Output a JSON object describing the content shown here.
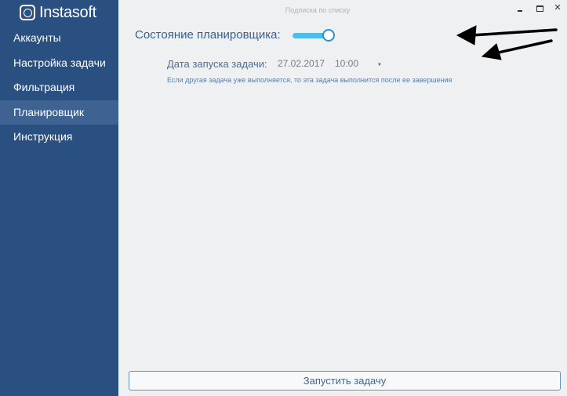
{
  "app": {
    "logo_text": "Instasoft",
    "window_title": "Подписка по списку"
  },
  "window_controls": {
    "minimize": "‒",
    "maximize": "□",
    "close": "✕"
  },
  "sidebar": {
    "items": [
      {
        "label": "Аккаунты",
        "active": false
      },
      {
        "label": "Настройка задачи",
        "active": false
      },
      {
        "label": "Фильтрация",
        "active": false
      },
      {
        "label": "Планировщик",
        "active": true
      },
      {
        "label": "Инструкция",
        "active": false
      }
    ]
  },
  "scheduler": {
    "state_label": "Состояние планировщика:",
    "enabled": true,
    "date_label": "Дата запуска задачи:",
    "date": "27.02.2017",
    "time": "10:00",
    "hint": "Если другая задача уже выполняется, то эта задача выполнится после ее завершения"
  },
  "footer": {
    "run_button": "Запустить задачу"
  },
  "colors": {
    "sidebar_bg": "#2a5082",
    "sidebar_active": "#3e6392",
    "toggle_on": "#4fbcee",
    "content_bg": "#eef0f2",
    "annotation_arrows": "#000000"
  },
  "icons": {
    "logo": "instasoft-logo-icon",
    "dropdown": "chevron-down-icon",
    "annotation": "arrow-left-icon"
  }
}
